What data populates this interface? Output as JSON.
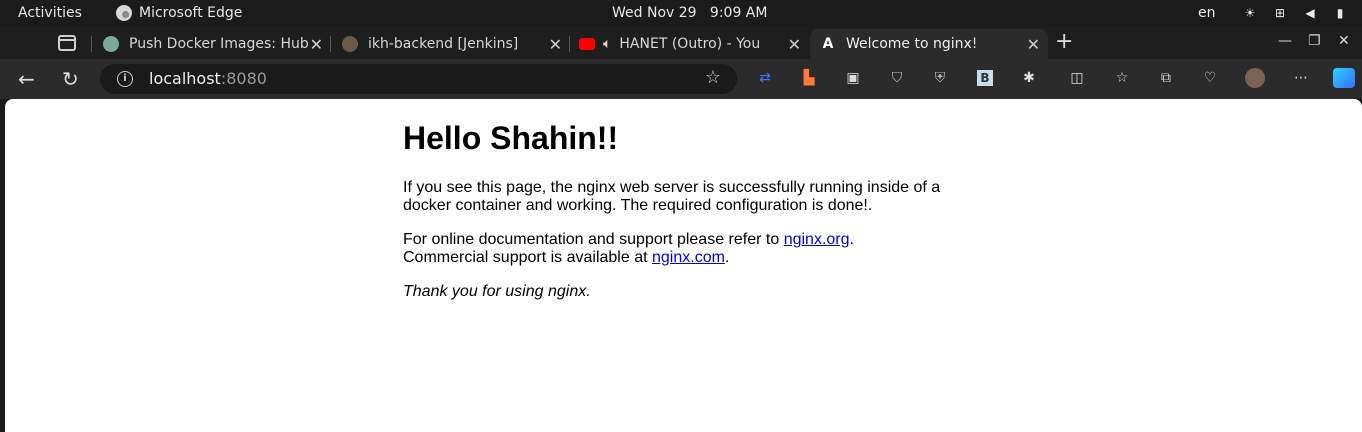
{
  "topbar": {
    "activities": "Activities",
    "app_name": "Microsoft Edge",
    "clock": "Wed Nov 29   9:09 AM",
    "lang": "en",
    "tray_icons": [
      "brightness-icon",
      "network-icon",
      "volume-icon",
      "battery-icon"
    ]
  },
  "tabs": [
    {
      "title": "Push Docker Images: Hub",
      "favicon": "chatgpt-icon"
    },
    {
      "title": "ikh-backend [Jenkins]",
      "favicon": "jenkins-icon"
    },
    {
      "title": "HANET (Outro) - YouT",
      "favicon": "youtube-icon",
      "audio": true
    },
    {
      "title": "Welcome to nginx!",
      "favicon": "angular-icon",
      "active": true
    }
  ],
  "address_bar": {
    "host": "localhost",
    "port": ":8080"
  },
  "page": {
    "heading": "Hello Shahin!!",
    "para1": "If you see this page, the nginx web server is successfully running inside of a docker container and working. The required configuration is done!.",
    "para2_prefix": "For online documentation and support please refer to ",
    "link1": "nginx.org",
    "para2_mid": ".",
    "para2_line2": "Commercial support is available at ",
    "link2": "nginx.com",
    "para2_end": ".",
    "thanks": "Thank you for using nginx."
  },
  "colors": {
    "link": "#0000ee",
    "chrome_dark": "#1b1b1b",
    "toolbar": "#2b2b2b"
  }
}
